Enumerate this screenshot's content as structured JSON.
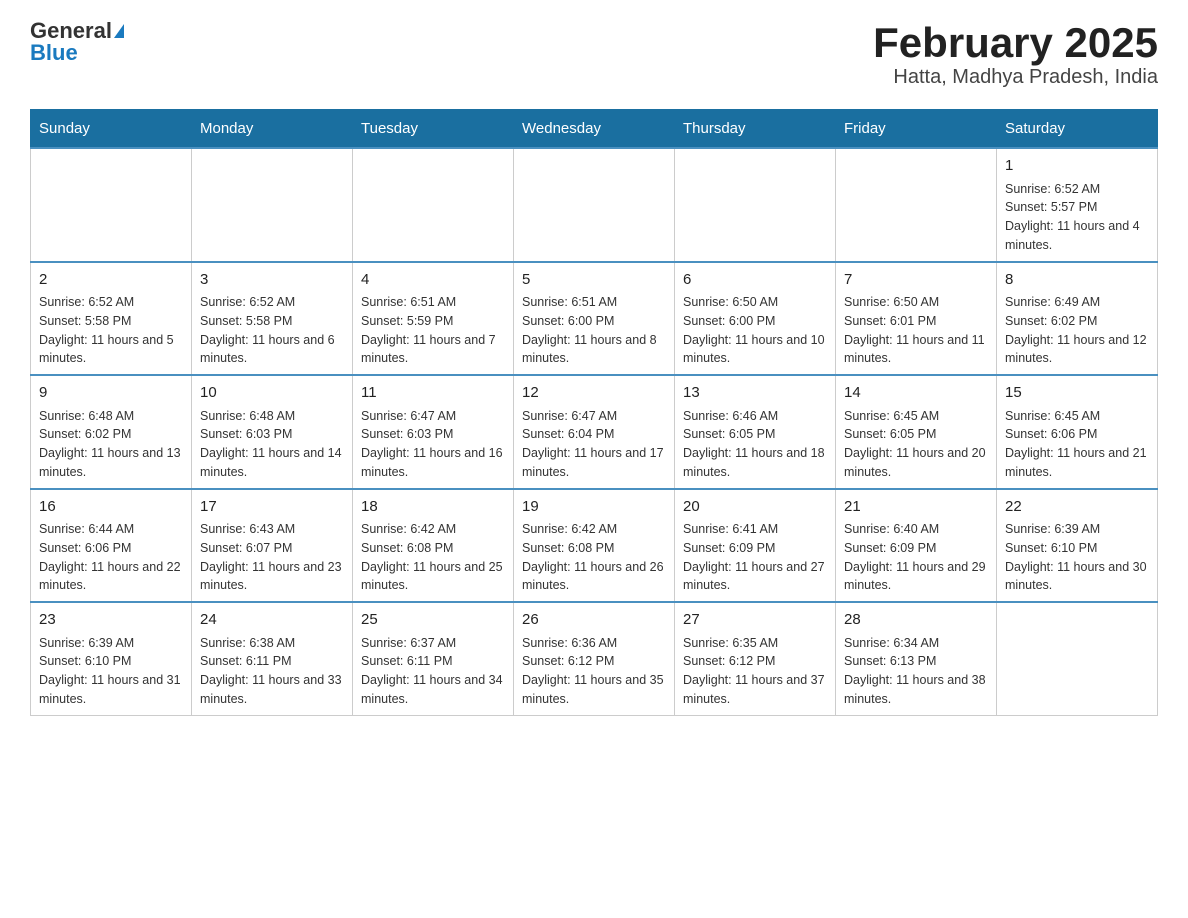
{
  "header": {
    "logo_general": "General",
    "logo_blue": "Blue",
    "title": "February 2025",
    "subtitle": "Hatta, Madhya Pradesh, India"
  },
  "weekdays": [
    "Sunday",
    "Monday",
    "Tuesday",
    "Wednesday",
    "Thursday",
    "Friday",
    "Saturday"
  ],
  "weeks": [
    [
      {
        "day": "",
        "info": ""
      },
      {
        "day": "",
        "info": ""
      },
      {
        "day": "",
        "info": ""
      },
      {
        "day": "",
        "info": ""
      },
      {
        "day": "",
        "info": ""
      },
      {
        "day": "",
        "info": ""
      },
      {
        "day": "1",
        "info": "Sunrise: 6:52 AM\nSunset: 5:57 PM\nDaylight: 11 hours and 4 minutes."
      }
    ],
    [
      {
        "day": "2",
        "info": "Sunrise: 6:52 AM\nSunset: 5:58 PM\nDaylight: 11 hours and 5 minutes."
      },
      {
        "day": "3",
        "info": "Sunrise: 6:52 AM\nSunset: 5:58 PM\nDaylight: 11 hours and 6 minutes."
      },
      {
        "day": "4",
        "info": "Sunrise: 6:51 AM\nSunset: 5:59 PM\nDaylight: 11 hours and 7 minutes."
      },
      {
        "day": "5",
        "info": "Sunrise: 6:51 AM\nSunset: 6:00 PM\nDaylight: 11 hours and 8 minutes."
      },
      {
        "day": "6",
        "info": "Sunrise: 6:50 AM\nSunset: 6:00 PM\nDaylight: 11 hours and 10 minutes."
      },
      {
        "day": "7",
        "info": "Sunrise: 6:50 AM\nSunset: 6:01 PM\nDaylight: 11 hours and 11 minutes."
      },
      {
        "day": "8",
        "info": "Sunrise: 6:49 AM\nSunset: 6:02 PM\nDaylight: 11 hours and 12 minutes."
      }
    ],
    [
      {
        "day": "9",
        "info": "Sunrise: 6:48 AM\nSunset: 6:02 PM\nDaylight: 11 hours and 13 minutes."
      },
      {
        "day": "10",
        "info": "Sunrise: 6:48 AM\nSunset: 6:03 PM\nDaylight: 11 hours and 14 minutes."
      },
      {
        "day": "11",
        "info": "Sunrise: 6:47 AM\nSunset: 6:03 PM\nDaylight: 11 hours and 16 minutes."
      },
      {
        "day": "12",
        "info": "Sunrise: 6:47 AM\nSunset: 6:04 PM\nDaylight: 11 hours and 17 minutes."
      },
      {
        "day": "13",
        "info": "Sunrise: 6:46 AM\nSunset: 6:05 PM\nDaylight: 11 hours and 18 minutes."
      },
      {
        "day": "14",
        "info": "Sunrise: 6:45 AM\nSunset: 6:05 PM\nDaylight: 11 hours and 20 minutes."
      },
      {
        "day": "15",
        "info": "Sunrise: 6:45 AM\nSunset: 6:06 PM\nDaylight: 11 hours and 21 minutes."
      }
    ],
    [
      {
        "day": "16",
        "info": "Sunrise: 6:44 AM\nSunset: 6:06 PM\nDaylight: 11 hours and 22 minutes."
      },
      {
        "day": "17",
        "info": "Sunrise: 6:43 AM\nSunset: 6:07 PM\nDaylight: 11 hours and 23 minutes."
      },
      {
        "day": "18",
        "info": "Sunrise: 6:42 AM\nSunset: 6:08 PM\nDaylight: 11 hours and 25 minutes."
      },
      {
        "day": "19",
        "info": "Sunrise: 6:42 AM\nSunset: 6:08 PM\nDaylight: 11 hours and 26 minutes."
      },
      {
        "day": "20",
        "info": "Sunrise: 6:41 AM\nSunset: 6:09 PM\nDaylight: 11 hours and 27 minutes."
      },
      {
        "day": "21",
        "info": "Sunrise: 6:40 AM\nSunset: 6:09 PM\nDaylight: 11 hours and 29 minutes."
      },
      {
        "day": "22",
        "info": "Sunrise: 6:39 AM\nSunset: 6:10 PM\nDaylight: 11 hours and 30 minutes."
      }
    ],
    [
      {
        "day": "23",
        "info": "Sunrise: 6:39 AM\nSunset: 6:10 PM\nDaylight: 11 hours and 31 minutes."
      },
      {
        "day": "24",
        "info": "Sunrise: 6:38 AM\nSunset: 6:11 PM\nDaylight: 11 hours and 33 minutes."
      },
      {
        "day": "25",
        "info": "Sunrise: 6:37 AM\nSunset: 6:11 PM\nDaylight: 11 hours and 34 minutes."
      },
      {
        "day": "26",
        "info": "Sunrise: 6:36 AM\nSunset: 6:12 PM\nDaylight: 11 hours and 35 minutes."
      },
      {
        "day": "27",
        "info": "Sunrise: 6:35 AM\nSunset: 6:12 PM\nDaylight: 11 hours and 37 minutes."
      },
      {
        "day": "28",
        "info": "Sunrise: 6:34 AM\nSunset: 6:13 PM\nDaylight: 11 hours and 38 minutes."
      },
      {
        "day": "",
        "info": ""
      }
    ]
  ]
}
